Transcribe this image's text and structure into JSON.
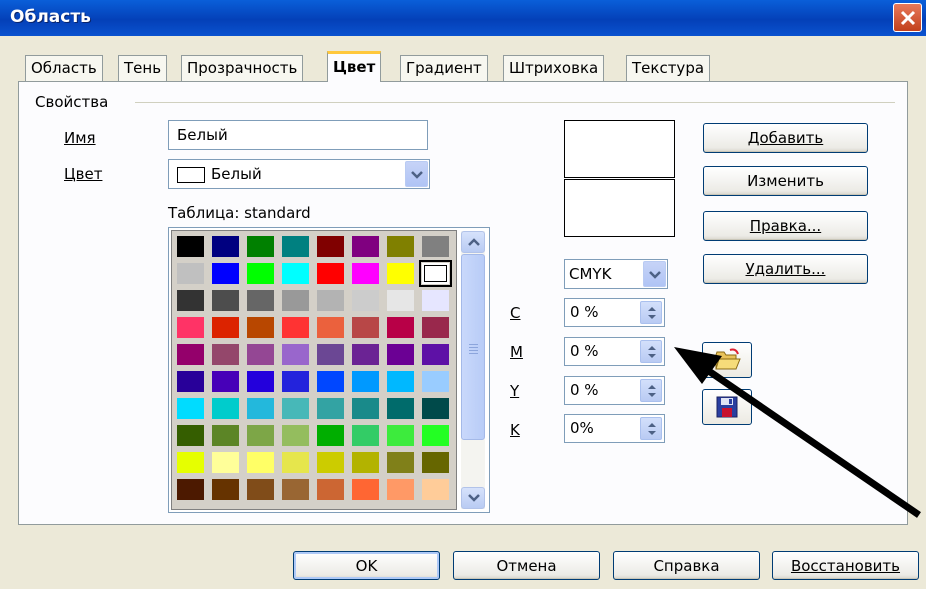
{
  "window": {
    "title": "Область"
  },
  "tabs": [
    {
      "label": "Область"
    },
    {
      "label": "Тень"
    },
    {
      "label": "Прозрачность"
    },
    {
      "label": "Цвет",
      "active": true
    },
    {
      "label": "Градиент"
    },
    {
      "label": "Штриховка"
    },
    {
      "label": "Текстура"
    }
  ],
  "properties": {
    "group_label": "Свойства",
    "name_label": "Имя",
    "name_value": "Белый",
    "color_label": "Цвет",
    "color_value": "Белый",
    "table_label": "Таблица: standard"
  },
  "palette": {
    "selected_index": 15,
    "colors": [
      "#000000",
      "#000080",
      "#008000",
      "#008080",
      "#800000",
      "#800080",
      "#808000",
      "#808080",
      "#c0c0c0",
      "#0000ff",
      "#00ff00",
      "#00ffff",
      "#ff0000",
      "#ff00ff",
      "#ffff00",
      "#ffffff",
      "#333333",
      "#4d4d4d",
      "#666666",
      "#999999",
      "#b3b3b3",
      "#cccccc",
      "#e6e6e6",
      "#e6e6ff",
      "#ff3366",
      "#dc2300",
      "#b84700",
      "#ff3333",
      "#eb613d",
      "#b84747",
      "#b80047",
      "#99284c",
      "#94006b",
      "#94476b",
      "#944794",
      "#9966cc",
      "#6b4794",
      "#6b2394",
      "#6b0094",
      "#5e11a6",
      "#280099",
      "#4700b8",
      "#2300dc",
      "#2323dc",
      "#0047ff",
      "#0099ff",
      "#00b8ff",
      "#99ccff",
      "#00dcff",
      "#00cccc",
      "#23b8dc",
      "#47b8b8",
      "#33a3a3",
      "#198a8a",
      "#006b6b",
      "#004a4a",
      "#355e00",
      "#5c8526",
      "#7da647",
      "#94bd5e",
      "#00ae00",
      "#33cc66",
      "#3deb3d",
      "#23ff23",
      "#e6ff00",
      "#ffff99",
      "#ffff66",
      "#e6e64c",
      "#cccc00",
      "#b3b300",
      "#808019",
      "#666600",
      "#4c1900",
      "#663300",
      "#804c19",
      "#996633",
      "#cc6633",
      "#ff6633",
      "#ff9966",
      "#ffcc99"
    ]
  },
  "color_model": {
    "selected": "CMYK",
    "channels": [
      {
        "label": "C",
        "value": "0 %"
      },
      {
        "label": "M",
        "value": "0 %"
      },
      {
        "label": "Y",
        "value": "0 %"
      },
      {
        "label": "K",
        "value": "0%"
      }
    ]
  },
  "actions": {
    "add": "Добавить",
    "modify": "Изменить",
    "edit": "Правка...",
    "delete": "Удалить..."
  },
  "footer": {
    "ok": "OK",
    "cancel": "Отмена",
    "help": "Справка",
    "reset": "Восстановить"
  }
}
